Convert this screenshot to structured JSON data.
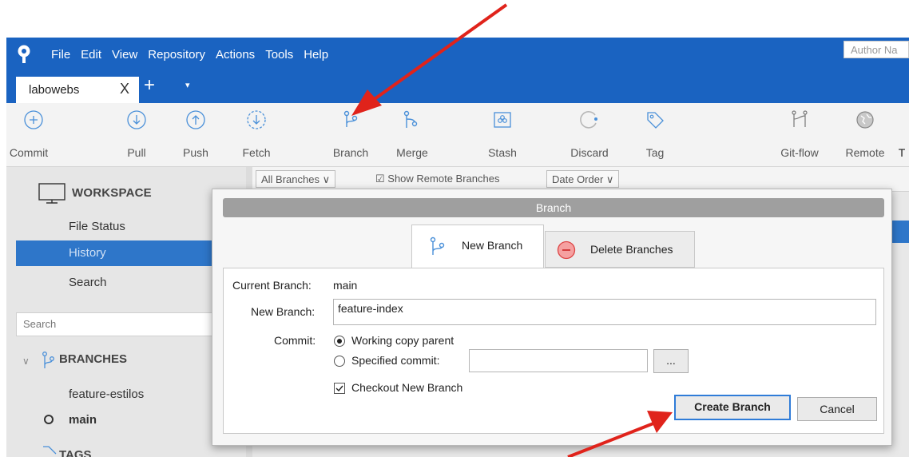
{
  "titlebar": {
    "menu": [
      "File",
      "Edit",
      "View",
      "Repository",
      "Actions",
      "Tools",
      "Help"
    ],
    "tab_label": "labowebs",
    "tab_close": "X",
    "new_tab": "+",
    "dropdown": "▾"
  },
  "toolbar": {
    "items": [
      "Commit",
      "Pull",
      "Push",
      "Fetch",
      "Branch",
      "Merge",
      "Stash",
      "Discard",
      "Tag",
      "Git-flow",
      "Remote",
      "T"
    ]
  },
  "sidebar": {
    "workspace": "WORKSPACE",
    "file_status": "File Status",
    "history": "History",
    "search": "Search",
    "search_placeholder": "Search",
    "branches": "BRANCHES",
    "branch_items": [
      "feature-estilos",
      "main"
    ],
    "tags": "TAGS"
  },
  "history_toolbar": {
    "all_branches": "All Branches",
    "show_remote": "Show Remote Branches",
    "date_order": "Date Order",
    "author_placeholder": "Author Na"
  },
  "dialog": {
    "title": "Branch",
    "tab_new": "New Branch",
    "tab_delete": "Delete Branches",
    "current_branch_label": "Current Branch:",
    "current_branch_value": "main",
    "new_branch_label": "New Branch:",
    "new_branch_value": "feature-index",
    "commit_label": "Commit:",
    "radio_working": "Working copy parent",
    "radio_specified": "Specified commit:",
    "browse_button": "...",
    "checkout_label": "Checkout New Branch",
    "create_button": "Create Branch",
    "cancel_button": "Cancel"
  },
  "colors": {
    "titlebar": "#1a63c1",
    "selection": "#2e76c9",
    "arrow": "#e0231b"
  }
}
